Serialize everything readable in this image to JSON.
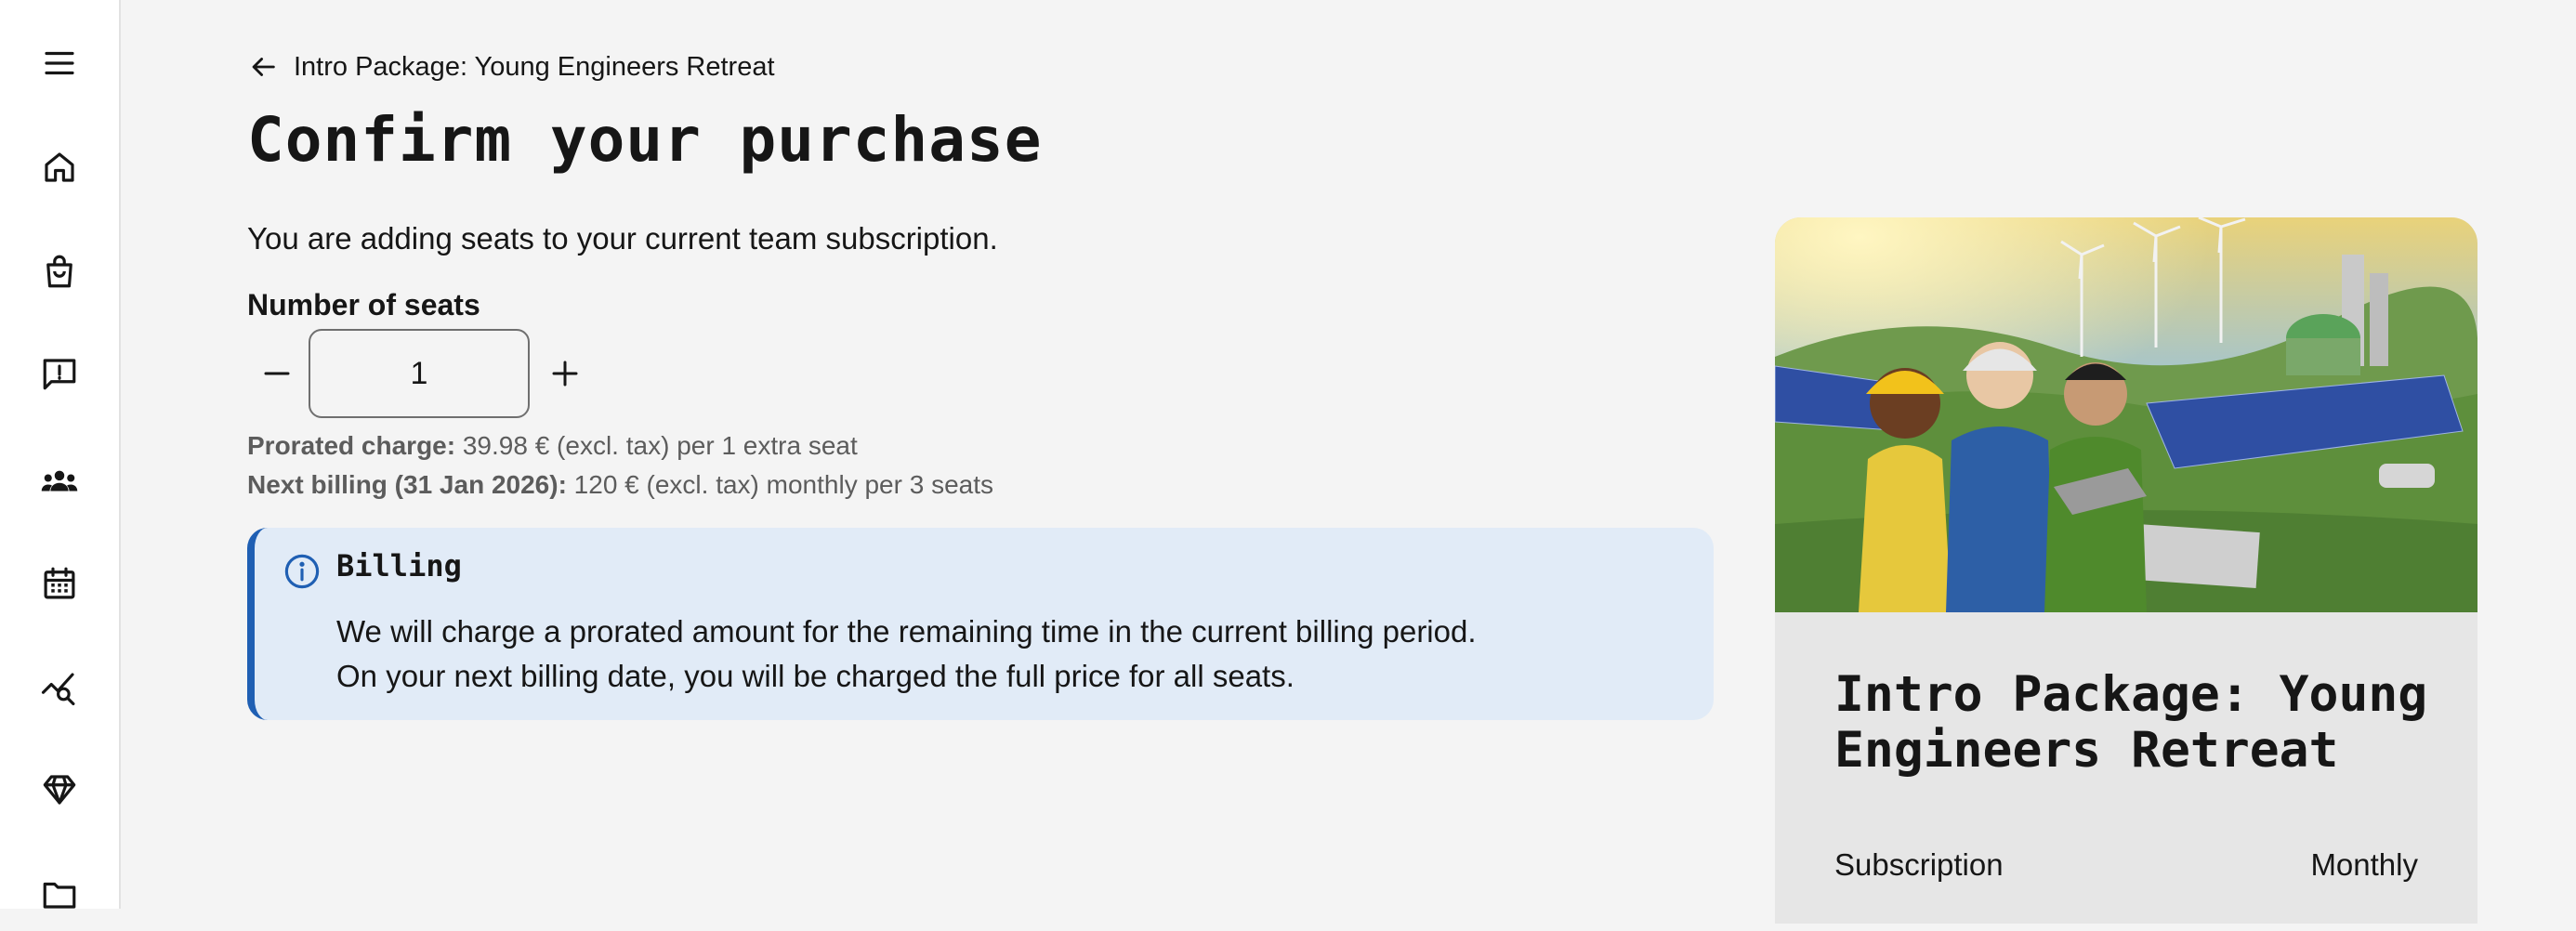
{
  "sidebar": {
    "items": [
      {
        "icon": "menu-icon"
      },
      {
        "icon": "home-icon"
      },
      {
        "icon": "shopping-bag-icon"
      },
      {
        "icon": "feedback-icon"
      },
      {
        "icon": "team-icon"
      },
      {
        "icon": "calendar-icon"
      },
      {
        "icon": "analytics-search-icon"
      },
      {
        "icon": "diamond-icon"
      },
      {
        "icon": "folder-icon"
      }
    ]
  },
  "breadcrumb": {
    "back_label": "Intro Package: Young Engineers Retreat"
  },
  "page": {
    "title": "Confirm your purchase",
    "intro": "You are adding seats to your current team subscription."
  },
  "seats": {
    "label": "Number of seats",
    "value": "1"
  },
  "charges": {
    "prorated_label": "Prorated charge:",
    "prorated_text": "39.98 € (excl. tax) per 1 extra seat",
    "next_label": "Next billing (31 Jan 2026):",
    "next_text": "120 € (excl. tax) monthly per 3 seats"
  },
  "notice": {
    "title": "Billing",
    "line1": "We will charge a prorated amount for the remaining time in the current billing period.",
    "line2": "On your next billing date, you will be charged the full price for all seats."
  },
  "product": {
    "title": "Intro Package: Young Engineers Retreat",
    "rows": [
      {
        "label": "Subscription",
        "value": "Monthly"
      }
    ]
  },
  "colors": {
    "accent": "#1f5fb3",
    "notice_bg": "#e1ebf7",
    "page_bg": "#f4f4f4",
    "card_bg": "#e6e6e6"
  }
}
